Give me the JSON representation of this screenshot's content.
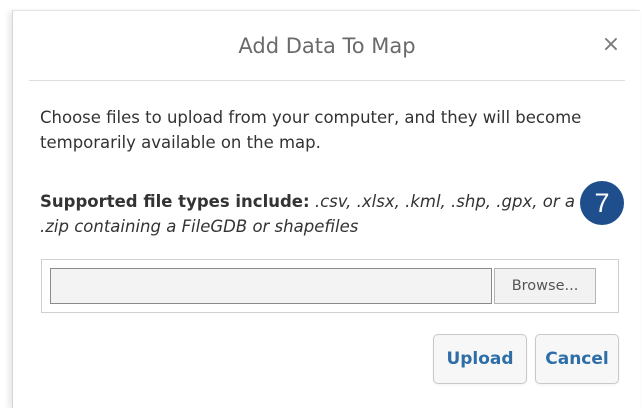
{
  "dialog": {
    "title": "Add Data To Map",
    "close_symbol": "×",
    "intro": "Choose files to upload from your computer, and they will become temporarily available on the map.",
    "file_types_label": "Supported file types include:",
    "file_types_list": " .csv, .xlsx, .kml, .shp, .gpx, or a .zip containing a FileGDB or shapefiles",
    "file_input": {
      "value": "",
      "browse_label": "Browse..."
    },
    "buttons": {
      "upload_label": "Upload",
      "cancel_label": "Cancel"
    }
  },
  "step_badge": {
    "number": "7",
    "color": "#1f4e8c"
  },
  "colors": {
    "button_text": "#2d6ea8",
    "title_text": "#6a6a6a"
  }
}
